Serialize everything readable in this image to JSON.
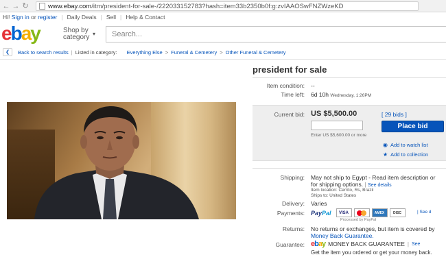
{
  "browser": {
    "url_domain": "www.ebay.com",
    "url_path": "/itm/president-for-sale-/222033152783?hash=item33b2350b0f:g:zvIAAOSwFNZWzeKD"
  },
  "toplinks": {
    "greeting": "Hi!",
    "sign_in": "Sign in",
    "or": "or",
    "register": "register",
    "daily_deals": "Daily Deals",
    "sell": "Sell",
    "help": "Help & Contact"
  },
  "header": {
    "logo": {
      "e": "e",
      "b": "b",
      "a": "a",
      "y": "y"
    },
    "shop_by": "Shop by",
    "category": "category",
    "search_placeholder": "Search..."
  },
  "breadcrumb": {
    "back": "Back to search results",
    "listed_in": "Listed in category:",
    "crumbs": [
      "Everything Else",
      "Funeral & Cemetery",
      "Other Funeral & Cemetery"
    ]
  },
  "item": {
    "title": "president for sale",
    "condition_label": "Item condition:",
    "condition_value": "--",
    "time_left_label": "Time left:",
    "time_left_value": "6d 10h",
    "time_left_detail": "Wednesday, 1:26PM"
  },
  "bid": {
    "current_label": "Current bid:",
    "current_value": "US $5,500.00",
    "bids": "[ 29 bids ]",
    "hint": "Enter US $5,600.00 or more",
    "place_bid": "Place bid",
    "watch": "Add to watch list",
    "collection": "Add to collection"
  },
  "details": {
    "shipping_label": "Shipping:",
    "shipping_line1": "May not ship to Egypt - Read item description or",
    "shipping_line2": "for shipping options.",
    "see_details": "See details",
    "item_location": "Item location: Cerrito, Rs, Brazil",
    "ships_to": "Ships to: United States",
    "delivery_label": "Delivery:",
    "delivery_value": "Varies",
    "payments_label": "Payments:",
    "paypal_pay": "Pay",
    "paypal_pal": "Pal",
    "processed": "Processed by PayPal",
    "see_desc": "See d",
    "returns_label": "Returns:",
    "returns_line1": "No returns or exchanges, but item is covered by",
    "returns_link": "Money Back Guarantee.",
    "guarantee_label": "Guarantee:",
    "guarantee_text": "MONEY BACK GUARANTEE",
    "guarantee_see": "See",
    "guarantee_line2": "Get the item you ordered or get your money back."
  },
  "colors": {
    "link": "#0654ba",
    "bid_panel": "#eeeeee",
    "place_bid": "#0654ba"
  }
}
